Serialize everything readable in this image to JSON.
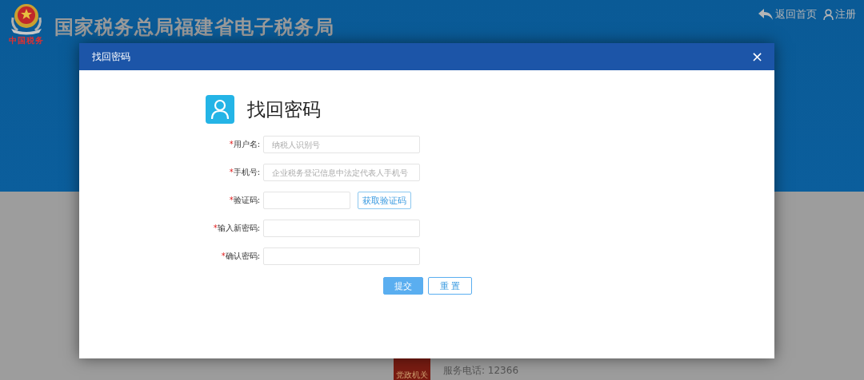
{
  "header": {
    "title": "国家税务总局福建省电子税务局",
    "emblem_caption": "中国税务",
    "links": [
      {
        "label": "返回首页",
        "kind": "back"
      },
      {
        "label": "注册",
        "kind": "user"
      }
    ]
  },
  "dialog": {
    "title": "找回密码",
    "close": "×",
    "heading": "找回密码",
    "fields": [
      {
        "mark": "*",
        "label": "用户名:",
        "placeholder": "纳税人识别号",
        "kind": "text"
      },
      {
        "mark": "*",
        "label": "手机号:",
        "placeholder": "企业税务登记信息中法定代表人手机号",
        "kind": "text"
      },
      {
        "mark": "*",
        "label": "验证码:",
        "kind": "captcha",
        "button": "获取验证码"
      },
      {
        "mark": "*",
        "label": "输入新密码:",
        "kind": "text"
      },
      {
        "mark": "*",
        "label": "确认密码:",
        "kind": "text"
      }
    ],
    "buttons": [
      {
        "label": "提交",
        "kind": "primary"
      },
      {
        "label": "重 置",
        "kind": "secondary"
      }
    ]
  },
  "footer": {
    "badge_caption": "党政机关",
    "phone": "服务电话: 12366"
  }
}
